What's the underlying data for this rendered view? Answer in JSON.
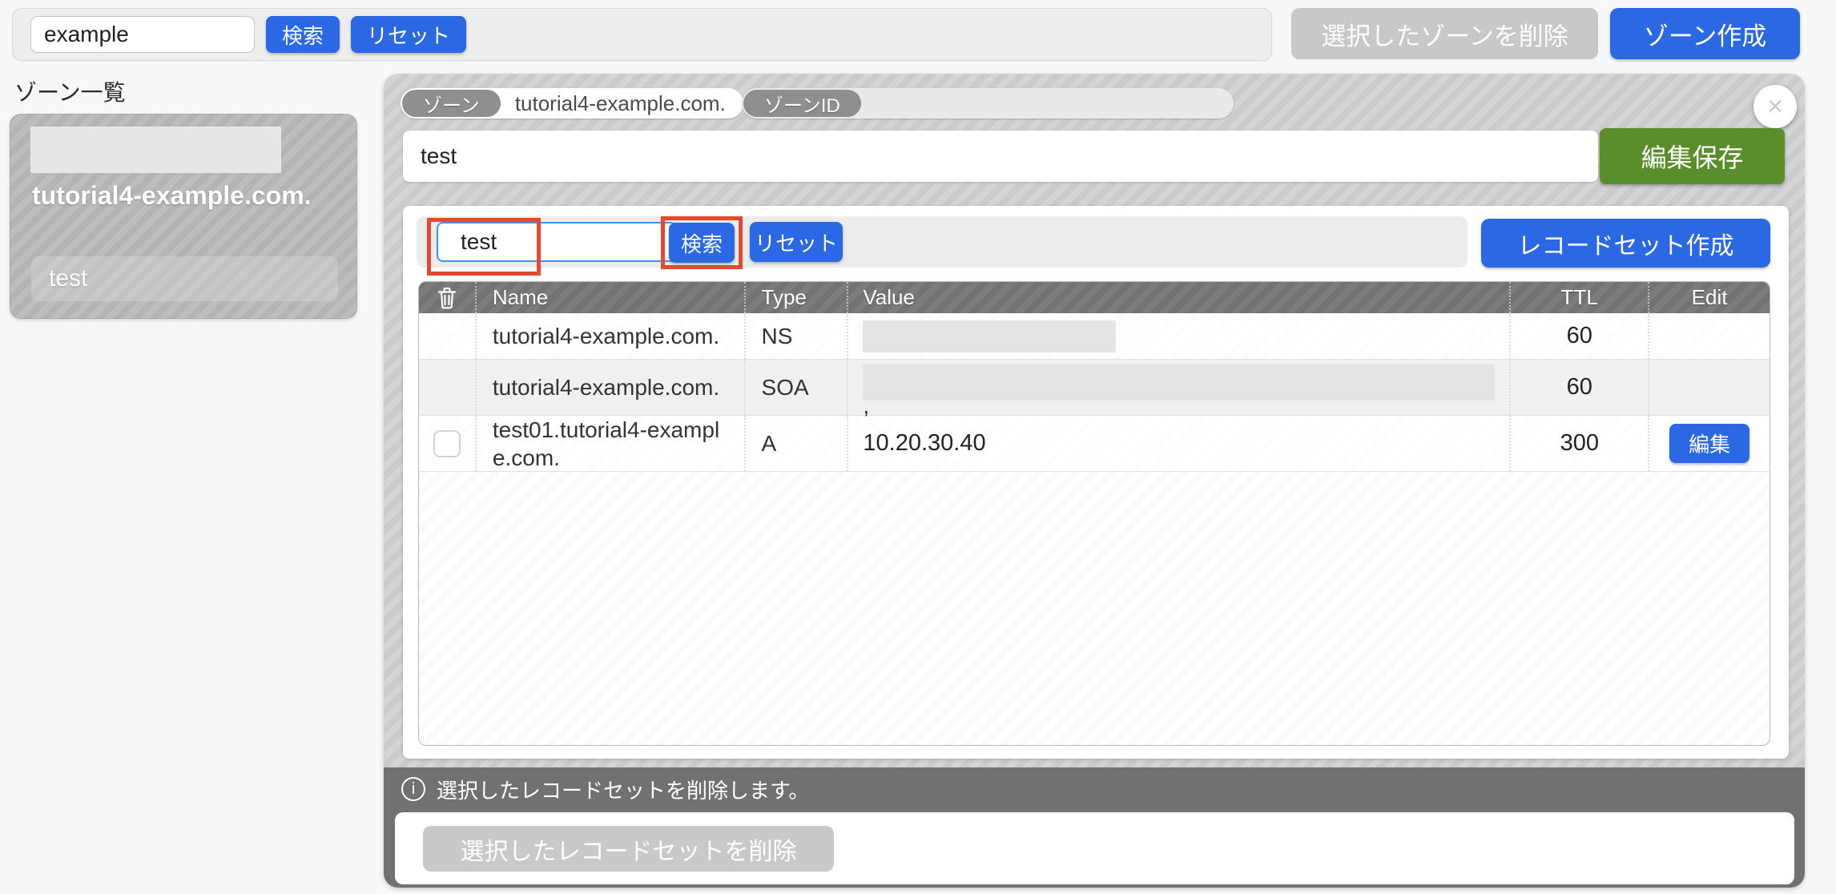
{
  "colors": {
    "primary_blue": "#2b68e4",
    "save_green": "#5a8e2b",
    "annotation_red": "#e2492e",
    "disabled_gray": "#c8c8ca",
    "panel_stripe_gray": "#cfcfcf",
    "footer_gray": "#717171"
  },
  "top_bar": {
    "search_input": {
      "value": "example",
      "placeholder": ""
    },
    "search_button": "検索",
    "reset_button": "リセット",
    "delete_zone_button": "選択したゾーンを削除",
    "create_zone_button": "ゾーン作成"
  },
  "sidebar": {
    "title": "ゾーン一覧",
    "zone_card": {
      "name": "tutorial4-example.com.",
      "sub_item": "test"
    }
  },
  "zone_panel": {
    "zone_label": "ゾーン",
    "zone_value": "tutorial4-example.com.",
    "zone_id_label": "ゾーンID",
    "zone_id_value": "",
    "close_button": "×",
    "name_input": {
      "value": "test"
    },
    "save_button": "編集保存",
    "records": {
      "search_input": {
        "value": "test"
      },
      "search_button": "検索",
      "reset_button": "リセット",
      "create_button": "レコードセット作成",
      "table": {
        "headers": {
          "name": "Name",
          "type": "Type",
          "value": "Value",
          "ttl": "TTL",
          "edit": "Edit"
        },
        "rows": [
          {
            "name": "tutorial4-example.com.",
            "type": "NS",
            "value_redacted": true,
            "value": "",
            "ttl": "60",
            "edit": ""
          },
          {
            "name": "tutorial4-example.com.",
            "type": "SOA",
            "value_redacted": true,
            "value": "",
            "value_suffix": ",",
            "ttl": "60",
            "edit": ""
          },
          {
            "name": "test01.tutorial4-example.com.",
            "type": "A",
            "value_redacted": false,
            "value": "10.20.30.40",
            "ttl": "300",
            "edit": "編集"
          }
        ]
      }
    },
    "footer": {
      "info_text": "選択したレコードセットを削除します。",
      "delete_button": "選択したレコードセットを削除"
    }
  }
}
